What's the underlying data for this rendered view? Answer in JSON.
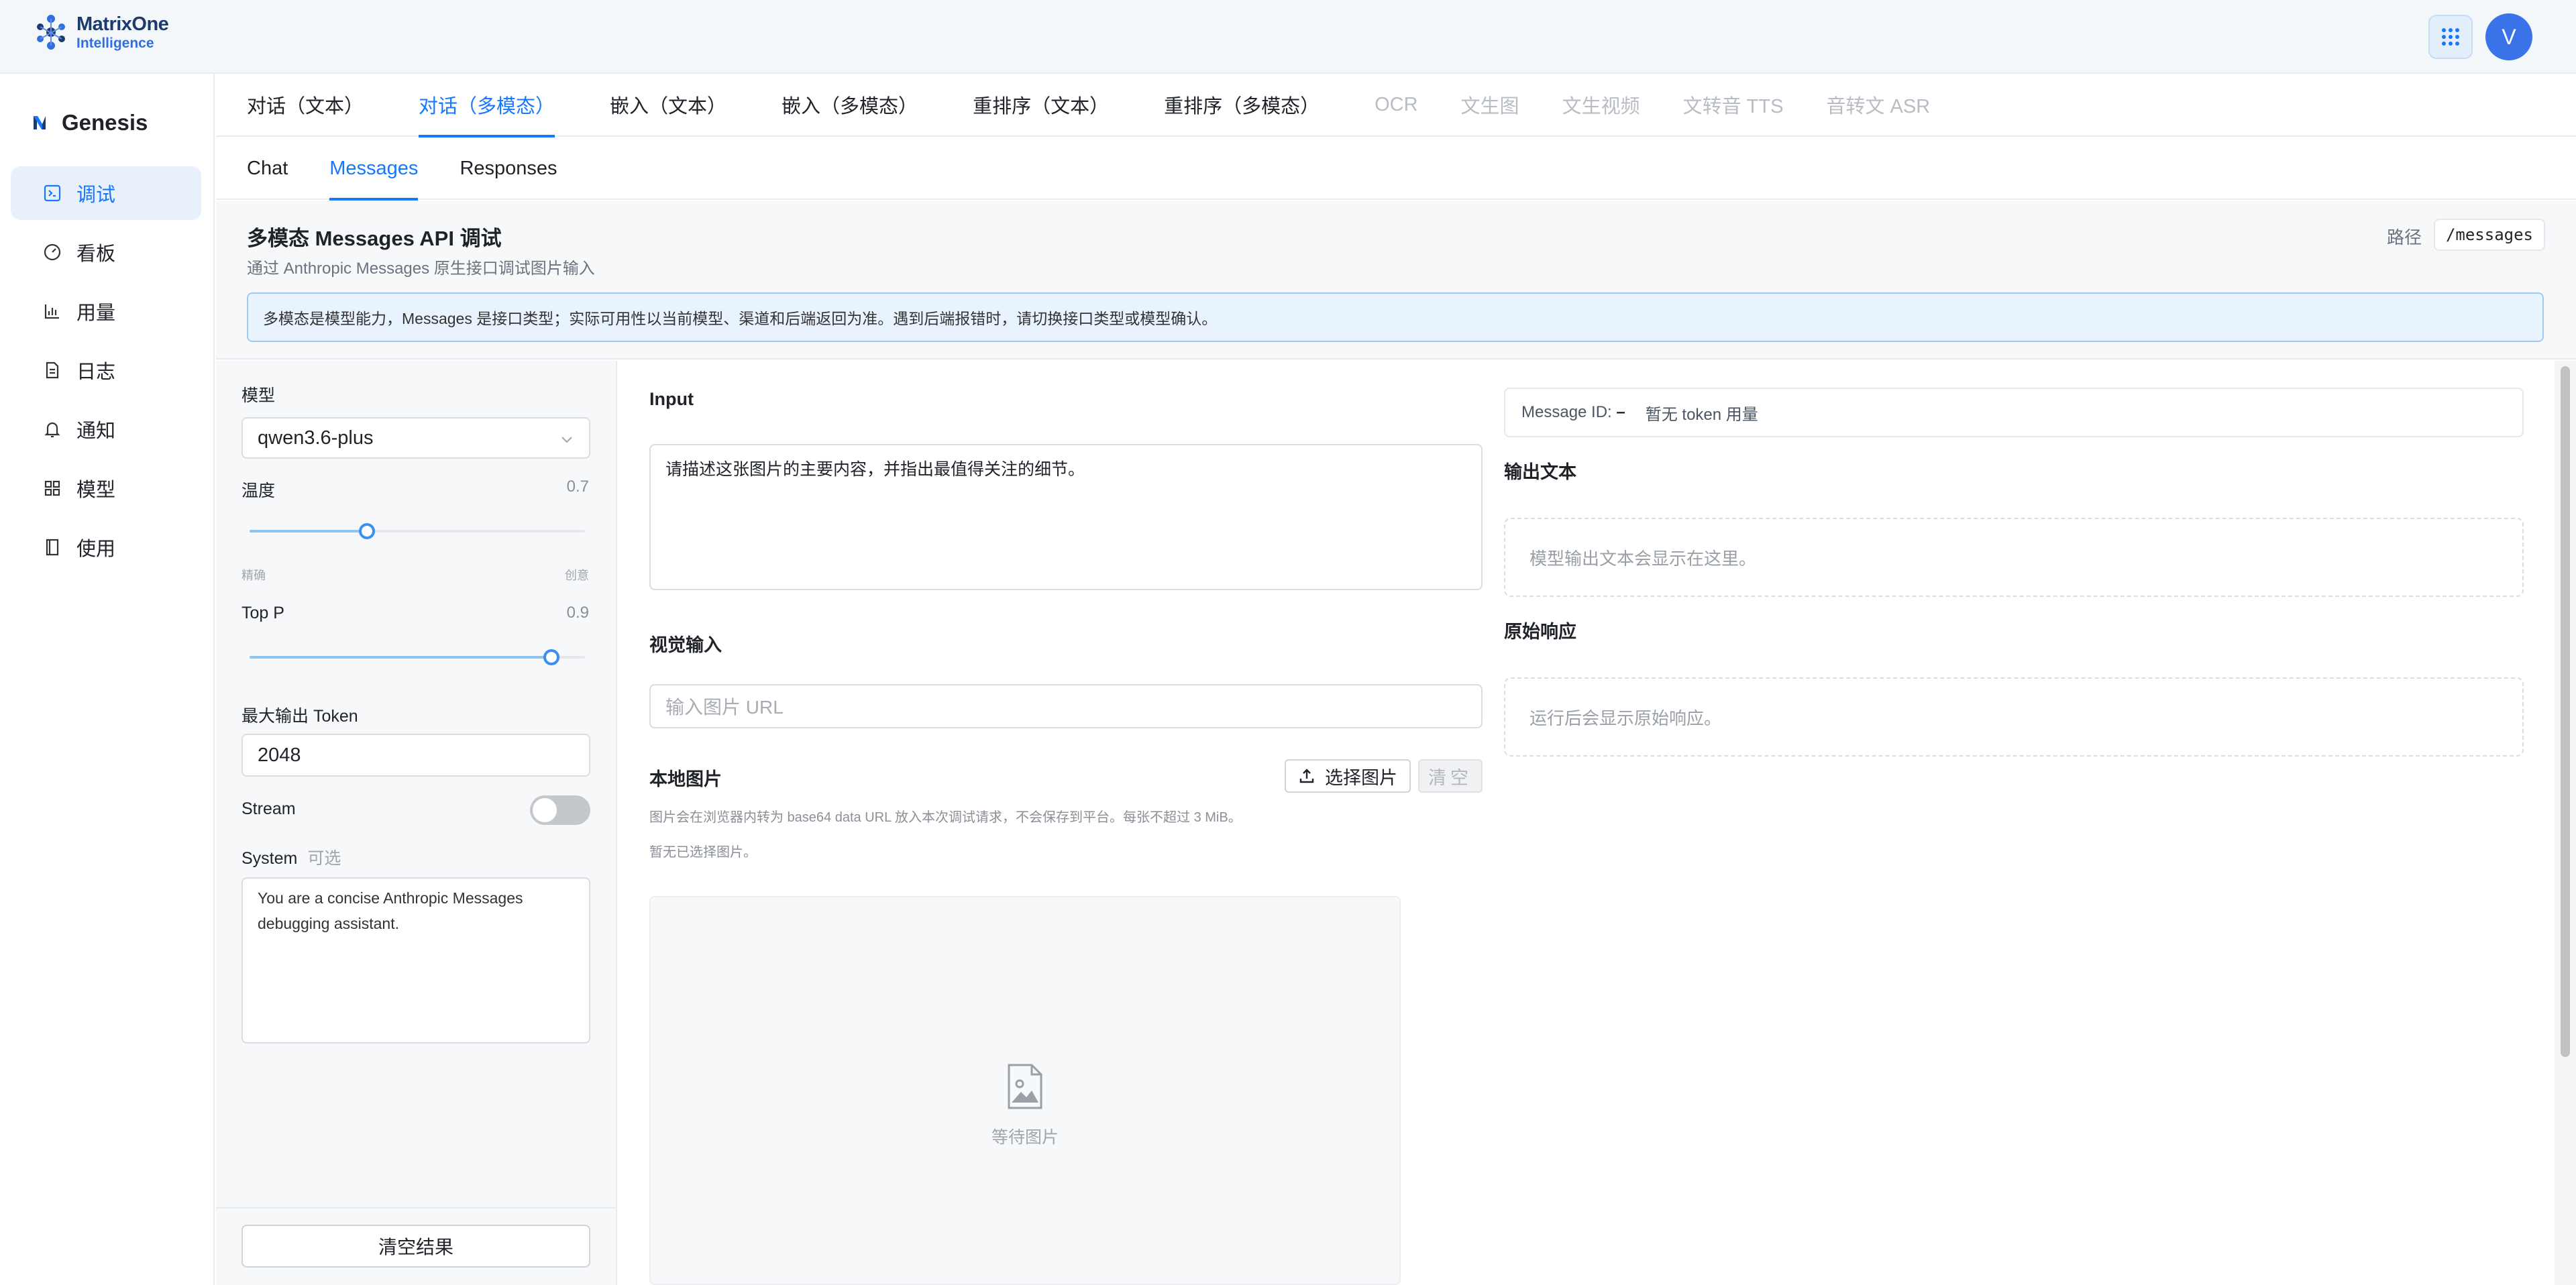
{
  "header": {
    "logo_line1": "MatrixOne",
    "logo_line2": "Intelligence",
    "avatar_initial": "V",
    "apps_icon": "grid-icon",
    "accent_color": "#1677ff"
  },
  "sidebar": {
    "brand": "Genesis",
    "items": [
      {
        "label": "调试",
        "icon": "terminal-icon",
        "active": true
      },
      {
        "label": "看板",
        "icon": "gauge-icon"
      },
      {
        "label": "用量",
        "icon": "bar-chart-icon"
      },
      {
        "label": "日志",
        "icon": "document-icon"
      },
      {
        "label": "通知",
        "icon": "bell-icon"
      },
      {
        "label": "模型",
        "icon": "grid-icon"
      },
      {
        "label": "使用",
        "icon": "book-icon"
      }
    ]
  },
  "tabs_primary": [
    {
      "label": "对话（文本）"
    },
    {
      "label": "对话（多模态）",
      "active": true
    },
    {
      "label": "嵌入（文本）"
    },
    {
      "label": "嵌入（多模态）"
    },
    {
      "label": "重排序（文本）"
    },
    {
      "label": "重排序（多模态）"
    },
    {
      "label": "OCR",
      "disabled": true
    },
    {
      "label": "文生图",
      "disabled": true
    },
    {
      "label": "文生视频",
      "disabled": true
    },
    {
      "label": "文转音 TTS",
      "disabled": true
    },
    {
      "label": "音转文 ASR",
      "disabled": true
    }
  ],
  "tabs_secondary": [
    {
      "label": "Chat"
    },
    {
      "label": "Messages",
      "active": true
    },
    {
      "label": "Responses"
    }
  ],
  "page": {
    "title": "多模态 Messages API 调试",
    "subtitle": "通过 Anthropic Messages 原生接口调试图片输入",
    "path_label": "路径",
    "path_value": "/messages",
    "alert": "多模态是模型能力，Messages 是接口类型；实际可用性以当前模型、渠道和后端返回为准。遇到后端报错时，请切换接口类型或模型确认。"
  },
  "params": {
    "model_label": "模型",
    "model_value": "qwen3.6-plus",
    "temperature_label": "温度",
    "temperature_value": "0.7",
    "temperature_fraction": 0.35,
    "temperature_min_label": "精确",
    "temperature_max_label": "创意",
    "top_p_label": "Top P",
    "top_p_value": "0.9",
    "top_p_fraction": 0.9,
    "max_tokens_label": "最大输出 Token",
    "max_tokens_value": "2048",
    "stream_label": "Stream",
    "stream_on": false,
    "system_label": "System",
    "system_optional": "可选",
    "system_value": "You are a concise Anthropic Messages debugging assistant.",
    "clear_results": "清空结果"
  },
  "input": {
    "label": "Input",
    "text": "请描述这张图片的主要内容，并指出最值得关注的细节。",
    "vision_label": "视觉输入",
    "url_placeholder": "输入图片 URL",
    "local_label": "本地图片",
    "select_button": "选择图片",
    "clear_button": "清空",
    "hint": "图片会在浏览器内转为 base64 data URL 放入本次调试请求，不会保存到平台。每张不超过 3 MiB。",
    "none_selected": "暂无已选择图片。",
    "waiting": "等待图片"
  },
  "output": {
    "message_id_label": "Message ID:",
    "message_id_value": "–",
    "token_usage": "暂无 token 用量",
    "output_label": "输出文本",
    "output_placeholder": "模型输出文本会显示在这里。",
    "raw_label": "原始响应",
    "raw_placeholder": "运行后会显示原始响应。"
  }
}
